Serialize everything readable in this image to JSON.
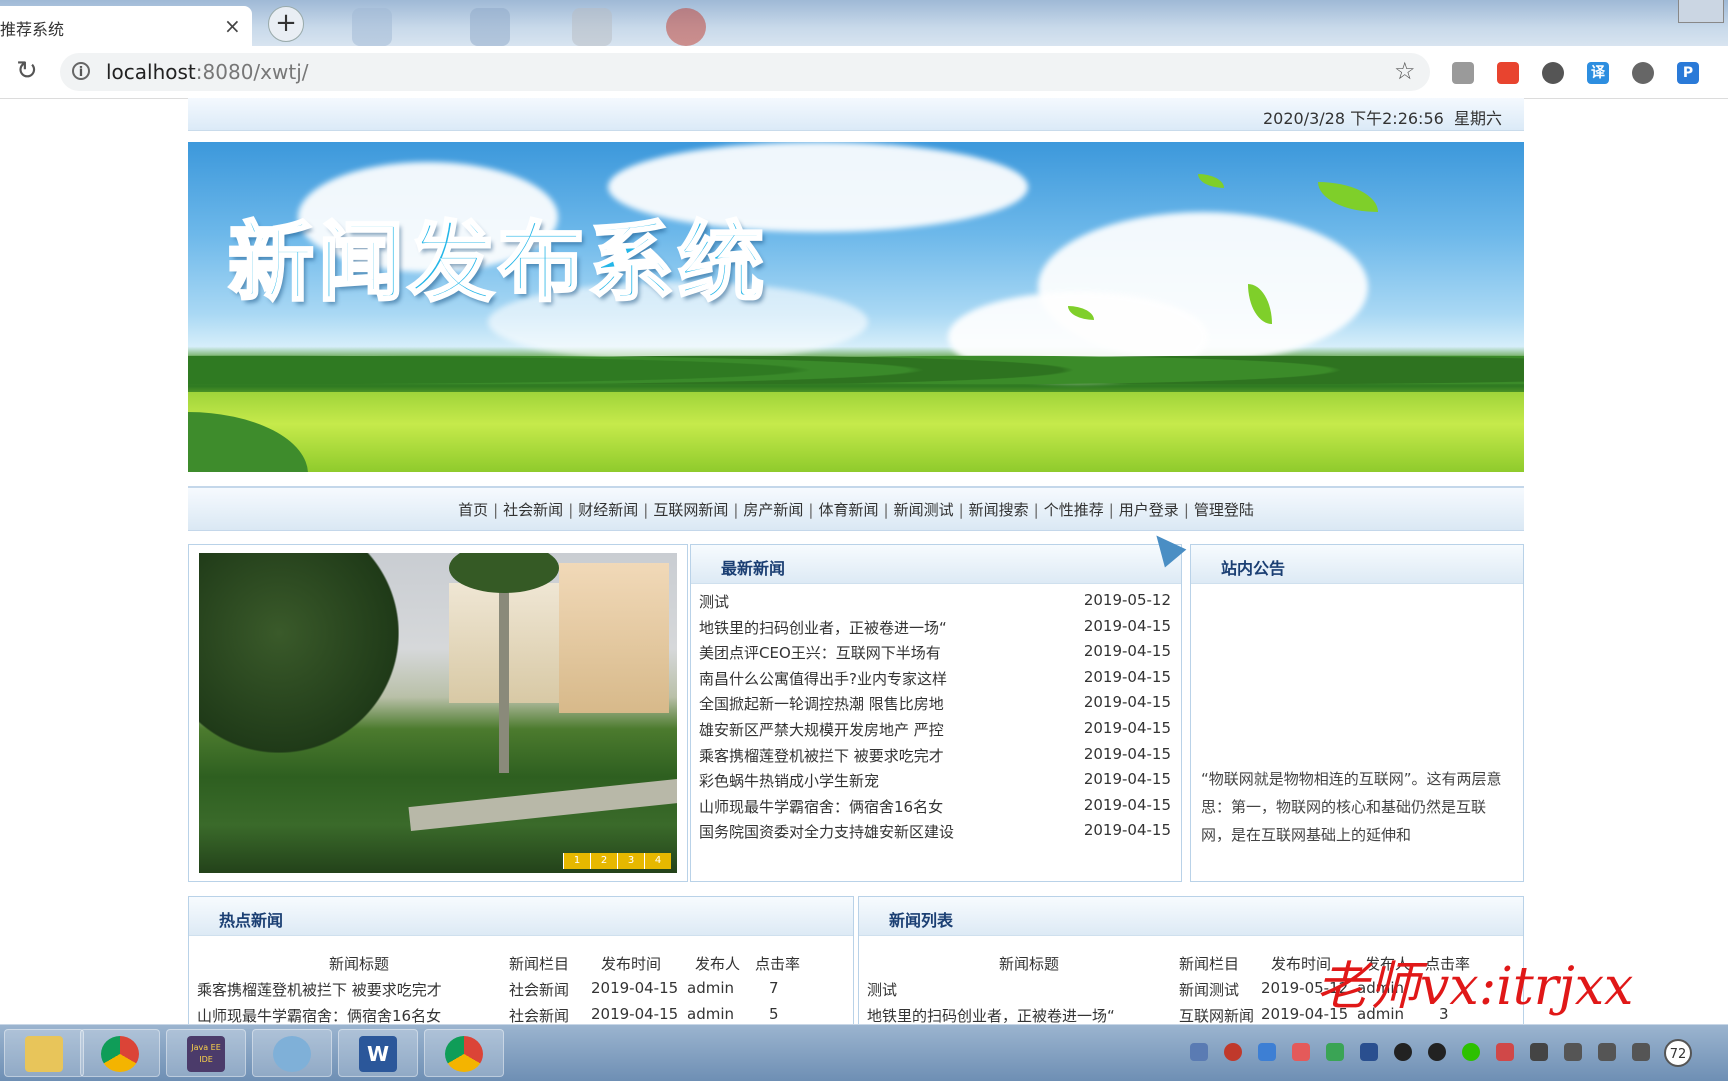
{
  "browser": {
    "tab_title": "推荐系统",
    "tab_close": "×",
    "new_tab": "+",
    "url_host": "localhost",
    "url_rest": ":8080/xwtj/",
    "reload_icon": "↻",
    "info_icon": "i",
    "star_icon": "☆",
    "extensions": [
      "grid-icon",
      "tomato-icon",
      "cloud-icon",
      "translate-icon",
      "settings-icon",
      "pocket-icon"
    ],
    "ext_labels": {
      "translate": "译",
      "pocket": "P"
    }
  },
  "header": {
    "datetime": "2020/3/28 下午2:26:56",
    "weekday": "星期六"
  },
  "banner": {
    "title": "新闻发布系统"
  },
  "nav": {
    "items": [
      "首页",
      "社会新闻",
      "财经新闻",
      "互联网新闻",
      "房产新闻",
      "体育新闻",
      "新闻测试",
      "新闻搜索",
      "个性推荐",
      "用户登录",
      "管理登陆"
    ],
    "separator": "|"
  },
  "slider": {
    "numbers": [
      "1",
      "2",
      "3",
      "4"
    ]
  },
  "latest": {
    "title": "最新新闻",
    "rows": [
      {
        "title": "测试",
        "date": "2019-05-12"
      },
      {
        "title": "地铁里的扫码创业者，正被卷进一场“",
        "date": "2019-04-15"
      },
      {
        "title": "美团点评CEO王兴：互联网下半场有",
        "date": "2019-04-15"
      },
      {
        "title": "南昌什么公寓值得出手?业内专家这样",
        "date": "2019-04-15"
      },
      {
        "title": "全国掀起新一轮调控热潮 限售比房地",
        "date": "2019-04-15"
      },
      {
        "title": "雄安新区严禁大规模开发房地产 严控",
        "date": "2019-04-15"
      },
      {
        "title": "乘客携榴莲登机被拦下 被要求吃完才",
        "date": "2019-04-15"
      },
      {
        "title": "彩色蜗牛热销成小学生新宠",
        "date": "2019-04-15"
      },
      {
        "title": "山师现最牛学霸宿舍：俩宿舍16名女",
        "date": "2019-04-15"
      },
      {
        "title": "国务院国资委对全力支持雄安新区建设",
        "date": "2019-04-15"
      }
    ]
  },
  "notice": {
    "title": "站内公告",
    "text": "“物联网就是物物相连的互联网”。这有两层意思：第一，物联网的核心和基础仍然是互联网，是在互联网基础上的延伸和"
  },
  "hot": {
    "title": "热点新闻",
    "headers": [
      "新闻标题",
      "新闻栏目",
      "发布时间",
      "发布人",
      "点击率"
    ],
    "rows": [
      [
        "乘客携榴莲登机被拦下 被要求吃完才",
        "社会新闻",
        "2019-04-15",
        "admin",
        "7"
      ],
      [
        "山师现最牛学霸宿舍：俩宿舍16名女",
        "社会新闻",
        "2019-04-15",
        "admin",
        "5"
      ]
    ]
  },
  "list": {
    "title": "新闻列表",
    "headers": [
      "新闻标题",
      "新闻栏目",
      "发布时间",
      "发布人",
      "点击率"
    ],
    "rows": [
      [
        "测试",
        "新闻测试",
        "2019-05-12",
        "admin",
        ""
      ],
      [
        "地铁里的扫码创业者，正被卷进一场“",
        "互联网新闻",
        "2019-04-15",
        "admin",
        "3"
      ]
    ]
  },
  "watermark": "老师vx:itrjxx",
  "taskbar": {
    "apps": [
      "explorer-icon",
      "chrome-icon",
      "javaee-ide-icon",
      "dolphin-icon",
      "word-icon",
      "chrome-icon"
    ],
    "ide_label": "Java EE IDE",
    "word_label": "W",
    "badge": "72"
  }
}
